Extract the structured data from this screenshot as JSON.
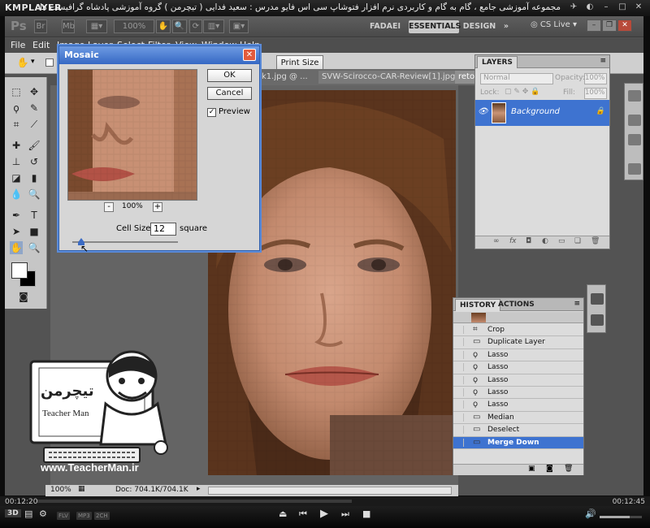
{
  "player": {
    "logo": "KMPLAYER",
    "title": "مجموعه آموزشی جامع ، گام به گام و کاربردی نرم افزار فتوشاپ سی اس فایو  مدرس : سعید فدایی ( تیچرمن ) گروه آموزشی پادشاه گرافیست ها",
    "time_current": "00:12:20",
    "time_total": "00:12:45",
    "progress": 0.52,
    "badges": [
      "FLV",
      "MP3",
      "2CH"
    ],
    "mode_label": "3D",
    "volume": 0.72
  },
  "photoshop": {
    "logo": "Ps",
    "zoom_box": "100%",
    "workspaces": [
      "FADAEI",
      "ESSENTIALS",
      "DESIGN"
    ],
    "more": "»",
    "cs_live": "CS Live",
    "menu": [
      "File",
      "Edit",
      "Image",
      "Layer",
      "Select",
      "Filter",
      "View",
      "Window",
      "Help"
    ],
    "options": {
      "print_size": "Print Size",
      "partial": "n"
    },
    "tabs": [
      "k1.jpg @ ...",
      "SVW-Scirocco-CAR-Review[1].jpg",
      "retou"
    ],
    "status": {
      "zoom": "100%",
      "doc": "Doc: 704.1K/704.1K"
    }
  },
  "mosaic": {
    "title": "Mosaic",
    "ok": "OK",
    "cancel": "Cancel",
    "preview_label": "Preview",
    "preview_checked": true,
    "zoom": "100%",
    "zoom_minus": "-",
    "zoom_plus": "+",
    "cell_label": "Cell Size:",
    "cell_value": "12",
    "cell_unit": "square"
  },
  "layers": {
    "tab": "LAYERS",
    "blend": "Normal",
    "opacity_label": "Opacity:",
    "opacity": "100%",
    "lock_label": "Lock:",
    "fill_label": "Fill:",
    "fill": "100%",
    "layer_name": "Background"
  },
  "history": {
    "tabs": [
      "HISTORY",
      "ACTIONS"
    ],
    "items": [
      "Crop",
      "Duplicate Layer",
      "Lasso",
      "Lasso",
      "Lasso",
      "Lasso",
      "Lasso",
      "Median",
      "Deselect",
      "Merge Down"
    ],
    "selected": "Merge Down"
  },
  "watermark": {
    "site": "www.TeacherMan.ir",
    "name": "Teacher Man",
    "persian": "تیچرمن"
  },
  "colors": {
    "accent": "#3e73d0",
    "ps_bg": "#535353",
    "panel": "#dcdcdc"
  }
}
